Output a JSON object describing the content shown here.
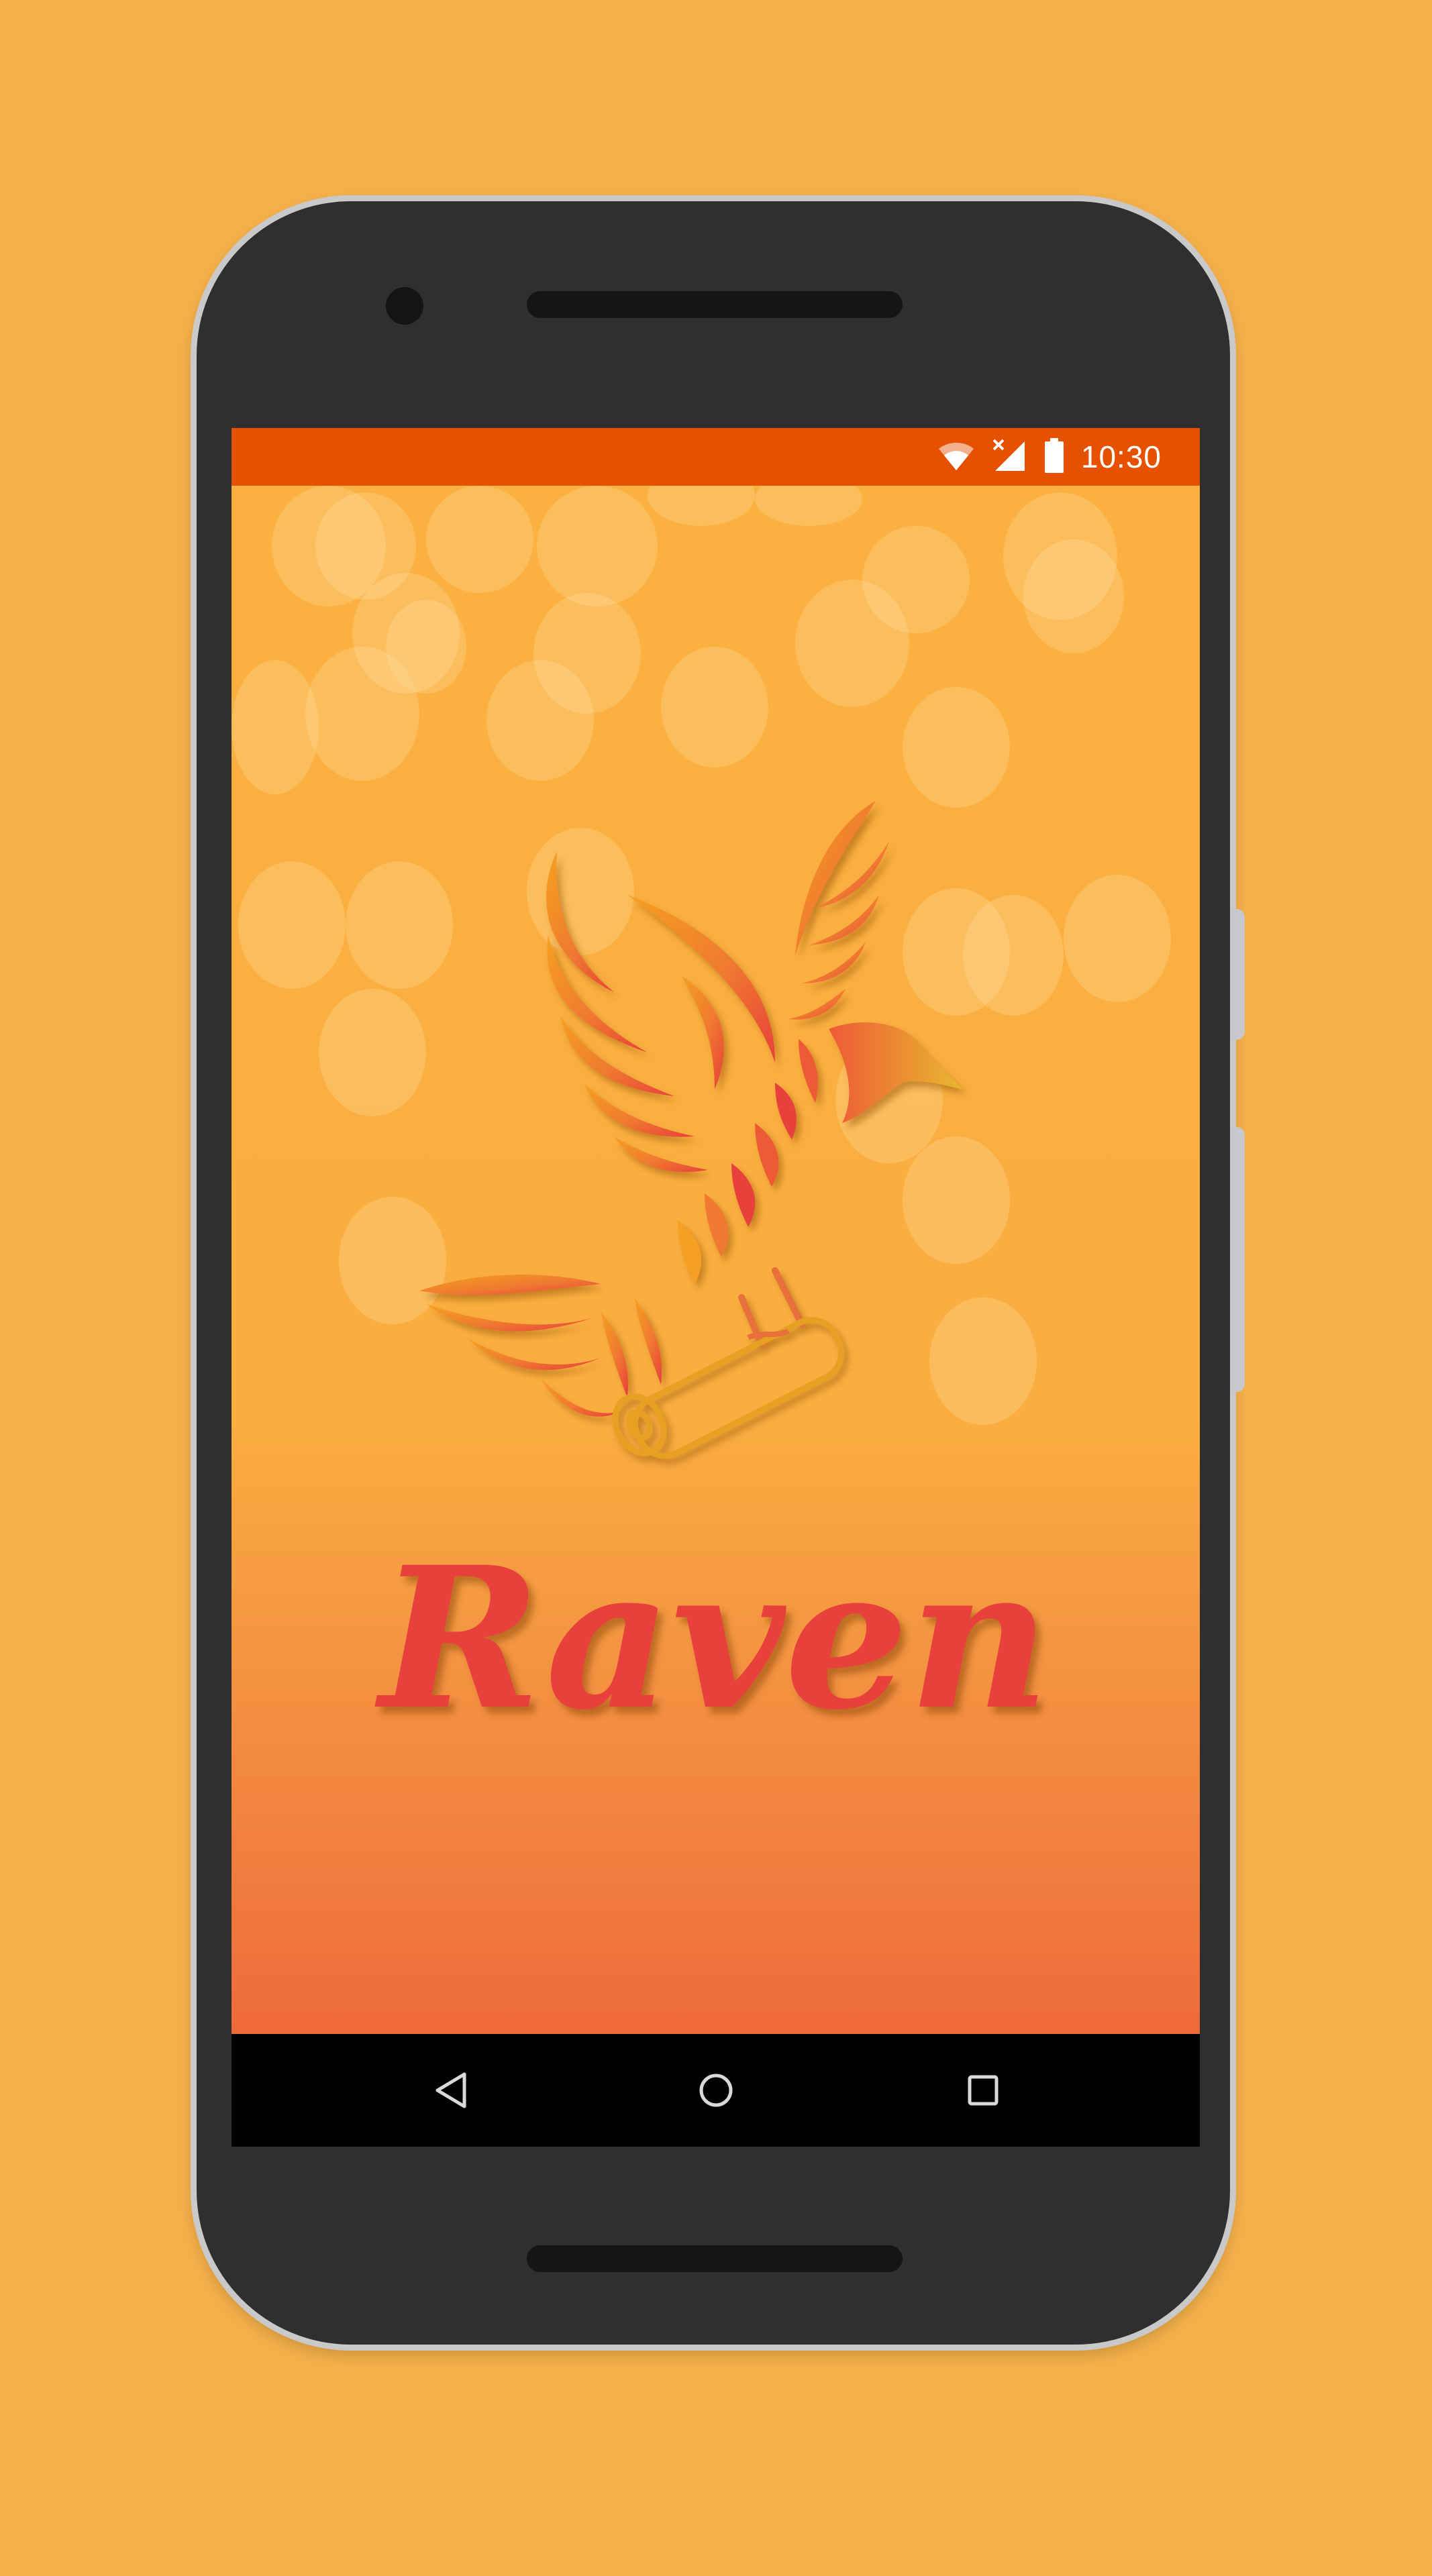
{
  "status_bar": {
    "time": "10:30",
    "icons": [
      "wifi-icon",
      "signal-no-data-icon",
      "battery-icon"
    ],
    "color": "#E65100"
  },
  "app": {
    "name": "Raven",
    "logo": "raven-with-scroll-logo",
    "accent_color": "#E8403A",
    "background_top": "#FBB03F",
    "background_bottom": "#EF6A3A"
  },
  "nav_bar": {
    "buttons": [
      "back-icon",
      "home-icon",
      "recents-icon"
    ]
  },
  "device": {
    "frame_color": "#2F2F2F",
    "backdrop_color": "#F6B14A"
  }
}
